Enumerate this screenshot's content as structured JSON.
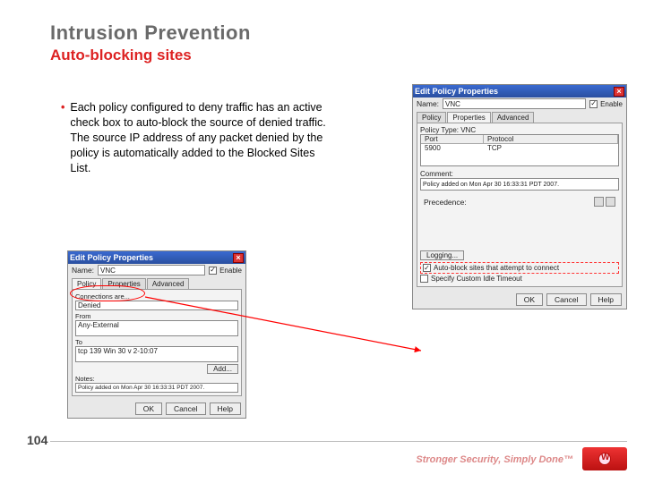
{
  "title": {
    "main": "Intrusion Prevention",
    "sub": "Auto-blocking sites"
  },
  "bullet": "Each policy configured to deny traffic has an active check box to auto-block the source of denied traffic. The source IP address of any packet denied by the policy is automatically added to the Blocked Sites List.",
  "pageNumber": "104",
  "footerTag": "Stronger Security, Simply Done™",
  "dlg": {
    "title": "Edit Policy Properties",
    "nameLabel": "Name:",
    "nameValue": "VNC",
    "enable": "Enable",
    "tabs": {
      "policy": "Policy",
      "properties": "Properties",
      "advanced": "Advanced"
    },
    "policyTypeLabel": "Policy Type: VNC",
    "portHdr": "Port",
    "protoHdr": "Protocol",
    "portVal": "5900",
    "protoVal": "TCP",
    "commentLabel": "Comment:",
    "commentVal": "Policy added on Mon Apr 30 16:33:31 PDT 2007.",
    "precedenceLabel": "Precedence:",
    "loggingBtn": "Logging...",
    "autoBlock": "Auto-block sites that attempt to connect",
    "customTimeout": "Specify Custom Idle Timeout",
    "small": {
      "connectionsAre": "Connections are...",
      "denied": "Denied",
      "from": "From",
      "anyExternal": "Any-External",
      "to": "To",
      "toVal": "tcp 139 Win 30 v 2-10:07",
      "addBtn": "Add...",
      "notesLabel": "Notes:",
      "notesVal": "Policy added on Mon Apr 30 16:33:31 PDT 2007."
    },
    "buttons": {
      "ok": "OK",
      "cancel": "Cancel",
      "help": "Help"
    }
  }
}
